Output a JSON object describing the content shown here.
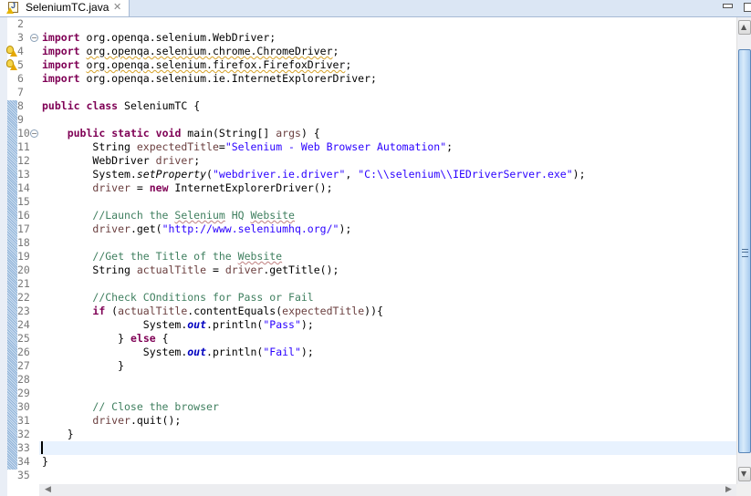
{
  "tab": {
    "title": "SeleniumTC.java",
    "icon": "java-file-icon",
    "warning_overlay": "warning-icon",
    "close_icon": "close-icon"
  },
  "window_controls": {
    "minimize": "minimize-icon",
    "maximize": "maximize-icon"
  },
  "editor": {
    "cursor_line": 33,
    "lines": [
      {
        "n": "2"
      },
      {
        "n": "3"
      },
      {
        "n": "4"
      },
      {
        "n": "5"
      },
      {
        "n": "6"
      },
      {
        "n": "7"
      },
      {
        "n": "8"
      },
      {
        "n": "9"
      },
      {
        "n": "10"
      },
      {
        "n": "11"
      },
      {
        "n": "12"
      },
      {
        "n": "13"
      },
      {
        "n": "14"
      },
      {
        "n": "15"
      },
      {
        "n": "16"
      },
      {
        "n": "17"
      },
      {
        "n": "18"
      },
      {
        "n": "19"
      },
      {
        "n": "20"
      },
      {
        "n": "21"
      },
      {
        "n": "22"
      },
      {
        "n": "23"
      },
      {
        "n": "24"
      },
      {
        "n": "25"
      },
      {
        "n": "26"
      },
      {
        "n": "27"
      },
      {
        "n": "28"
      },
      {
        "n": "29"
      },
      {
        "n": "30"
      },
      {
        "n": "31"
      },
      {
        "n": "32"
      },
      {
        "n": "33"
      },
      {
        "n": "34"
      },
      {
        "n": "35"
      }
    ],
    "tokens": {
      "import": "import",
      "imp3": " org.openqa.selenium.WebDriver;",
      "imp4a": " ",
      "imp4b": "org.openqa.selenium.chrome.ChromeDriver",
      "imp4c": ";",
      "imp5b": "org.openqa.selenium.firefox.FirefoxDriver",
      "imp6": " org.openqa.selenium.ie.InternetExplorerDriver;",
      "public": "public",
      "class": "class",
      "l8rest": " SeleniumTC {",
      "static": "static",
      "void": "void",
      "l10a": " main(String[] ",
      "args": "args",
      "l10b": ") {",
      "l11a": "String ",
      "expectedTitle": "expectedTitle",
      "eq": "=",
      "l11str": "\"Selenium - Web Browser Automation\"",
      "semi": ";",
      "l12a": "WebDriver ",
      "driver": "driver",
      "l13a": "System.",
      "setProperty": "setProperty",
      "l13b": "(",
      "l13s1": "\"webdriver.ie.driver\"",
      "comma": ", ",
      "l13s2": "\"C:\\\\selenium\\\\IEDriverServer.exe\"",
      "l13c": ");",
      "l14b": " = ",
      "new": "new",
      "l14c": " InternetExplorerDriver();",
      "l16a": "//Launch the ",
      "l16b": "Selenium",
      "l16c": " HQ ",
      "l16d": "Website",
      "l17a": ".get(",
      "l17s": "\"http://www.seleniumhq.org/\"",
      "l17b": ");",
      "l19a": "//Get the Title of the ",
      "l19b": "Website",
      "l20a": "String ",
      "actualTitle": "actualTitle",
      "l20b": " = ",
      "l20c": ".getTitle();",
      "l22": "//Check COnditions for Pass or Fail",
      "if": "if",
      "l23a": " (",
      "l23b": ".contentEquals(",
      "l23c": ")){",
      "out": "out",
      "println": ".println(",
      "pass": "\"Pass\"",
      "fail": "\"Fail\"",
      "brace_close": "}",
      "else": "else",
      "l25b": " {",
      "l30": "// Close the browser",
      "l31": ".quit();",
      "l34": "}"
    }
  },
  "scrollbars": {
    "up_arrow": "▲",
    "down_arrow": "▼",
    "left_arrow": "◀",
    "right_arrow": "▶"
  }
}
